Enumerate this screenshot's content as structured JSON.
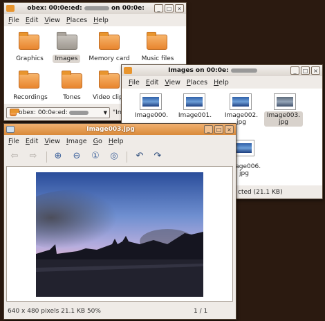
{
  "win1": {
    "title": "obex: 00:0e:ed:",
    "title_suffix": "on 00:0e:",
    "menu": [
      "File",
      "Edit",
      "View",
      "Places",
      "Help"
    ],
    "folders": [
      "Graphics",
      "Images",
      "Memory card",
      "Music files",
      "Recordings",
      "Tones",
      "Video clip"
    ],
    "path": "obex: 00:0e:ed:",
    "path_extra": "\"Im"
  },
  "win2": {
    "title": "Images on 00:0e:",
    "menu": [
      "File",
      "Edit",
      "View",
      "Places",
      "Help"
    ],
    "files": [
      {
        "line1": "Image000.",
        "line2": ""
      },
      {
        "line1": "Image001.",
        "line2": ""
      },
      {
        "line1": "Image002.",
        "line2": "jpg"
      },
      {
        "line1": "Image003.",
        "line2": "jpg"
      },
      {
        "line1": "",
        "line2": "Image006."
      },
      {
        "line1": "",
        "line2": "jpg"
      }
    ],
    "status": "cted (21.1 KB)"
  },
  "win3": {
    "title": "Image003.jpg",
    "menu": [
      "File",
      "Edit",
      "View",
      "Image",
      "Go",
      "Help"
    ],
    "status_left": "640 x 480 pixels  21.1 KB  50%",
    "status_right": "1 / 1"
  },
  "colors": {
    "active_title": "#d98a3a",
    "desktop": "#2b1a10",
    "folder": "#f0a050"
  }
}
